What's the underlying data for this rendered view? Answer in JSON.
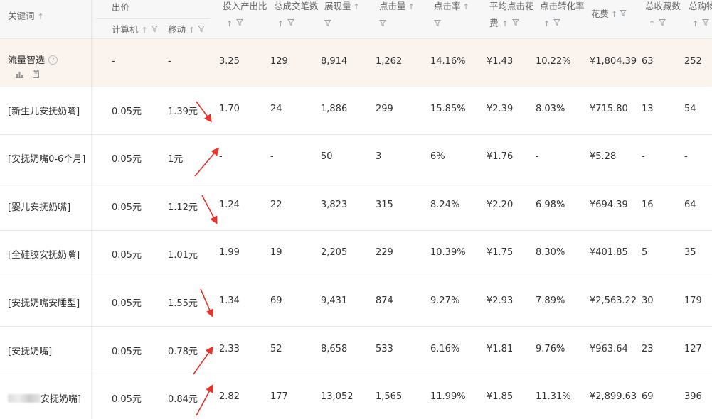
{
  "header": {
    "keyword": "关键词",
    "bid": "出价",
    "bid_pc": "计算机",
    "bid_mobile": "移动",
    "roi": "投入产出比",
    "deals": "总成交笔数",
    "impressions": "展现量",
    "clicks": "点击量",
    "ctr": "点击率",
    "avg_cpc_line1": "平均点击花",
    "avg_cpc_line2": "费",
    "cvr": "点击转化率",
    "spend": "花费",
    "favorites": "总收藏数",
    "carts": "总购物"
  },
  "icons": {
    "sort": "↑",
    "filter": "filter-funnel-icon",
    "help": "?"
  },
  "summary": {
    "keyword": "流量智选",
    "bid_pc": "-",
    "bid_mobile": "-",
    "roi": "3.25",
    "deals": "129",
    "impressions": "8,914",
    "clicks": "1,262",
    "ctr": "14.16%",
    "avg_cpc": "¥1.43",
    "cvr": "10.22%",
    "spend": "¥1,804.39",
    "favorites": "63",
    "carts": "252"
  },
  "rows": [
    {
      "keyword": "[新生儿安抚奶嘴]",
      "bid_pc": "0.05元",
      "bid_mobile": "1.39元",
      "roi": "1.70",
      "deals": "24",
      "impressions": "1,886",
      "clicks": "299",
      "ctr": "15.85%",
      "avg_cpc": "¥2.39",
      "cvr": "8.03%",
      "spend": "¥715.80",
      "favorites": "13",
      "carts": "54"
    },
    {
      "keyword": "[安抚奶嘴0-6个月]",
      "bid_pc": "0.05元",
      "bid_mobile": "1元",
      "roi": "-",
      "deals": "-",
      "impressions": "50",
      "clicks": "3",
      "ctr": "6%",
      "avg_cpc": "¥1.76",
      "cvr": "-",
      "spend": "¥5.28",
      "favorites": "-",
      "carts": "-"
    },
    {
      "keyword": "[婴儿安抚奶嘴]",
      "bid_pc": "0.05元",
      "bid_mobile": "1.12元",
      "roi": "1.24",
      "deals": "22",
      "impressions": "3,823",
      "clicks": "315",
      "ctr": "8.24%",
      "avg_cpc": "¥2.20",
      "cvr": "6.98%",
      "spend": "¥694.39",
      "favorites": "16",
      "carts": "64"
    },
    {
      "keyword": "[全硅胶安抚奶嘴]",
      "bid_pc": "0.05元",
      "bid_mobile": "1.01元",
      "roi": "1.99",
      "deals": "19",
      "impressions": "2,205",
      "clicks": "229",
      "ctr": "10.39%",
      "avg_cpc": "¥1.75",
      "cvr": "8.30%",
      "spend": "¥401.85",
      "favorites": "5",
      "carts": "35"
    },
    {
      "keyword": "[安抚奶嘴安睡型]",
      "bid_pc": "0.05元",
      "bid_mobile": "1.55元",
      "roi": "1.34",
      "deals": "69",
      "impressions": "9,431",
      "clicks": "874",
      "ctr": "9.27%",
      "avg_cpc": "¥2.93",
      "cvr": "7.89%",
      "spend": "¥2,563.22",
      "favorites": "30",
      "carts": "179"
    },
    {
      "keyword": "[安抚奶嘴]",
      "bid_pc": "0.05元",
      "bid_mobile": "0.78元",
      "roi": "2.33",
      "deals": "52",
      "impressions": "8,658",
      "clicks": "533",
      "ctr": "6.16%",
      "avg_cpc": "¥1.81",
      "cvr": "9.76%",
      "spend": "¥963.64",
      "favorites": "23",
      "carts": "127"
    },
    {
      "keyword": "安抚奶嘴]",
      "bid_pc": "0.05元",
      "bid_mobile": "0.84元",
      "roi": "2.82",
      "deals": "177",
      "impressions": "13,052",
      "clicks": "1,565",
      "ctr": "11.99%",
      "avg_cpc": "¥1.85",
      "cvr": "11.31%",
      "spend": "¥2,899.63",
      "favorites": "69",
      "carts": "396"
    }
  ],
  "colors": {
    "header_bg": "#f7f7f7",
    "summary_bg": "#fbf3ee",
    "annotation_arrow": "#e8322a"
  }
}
